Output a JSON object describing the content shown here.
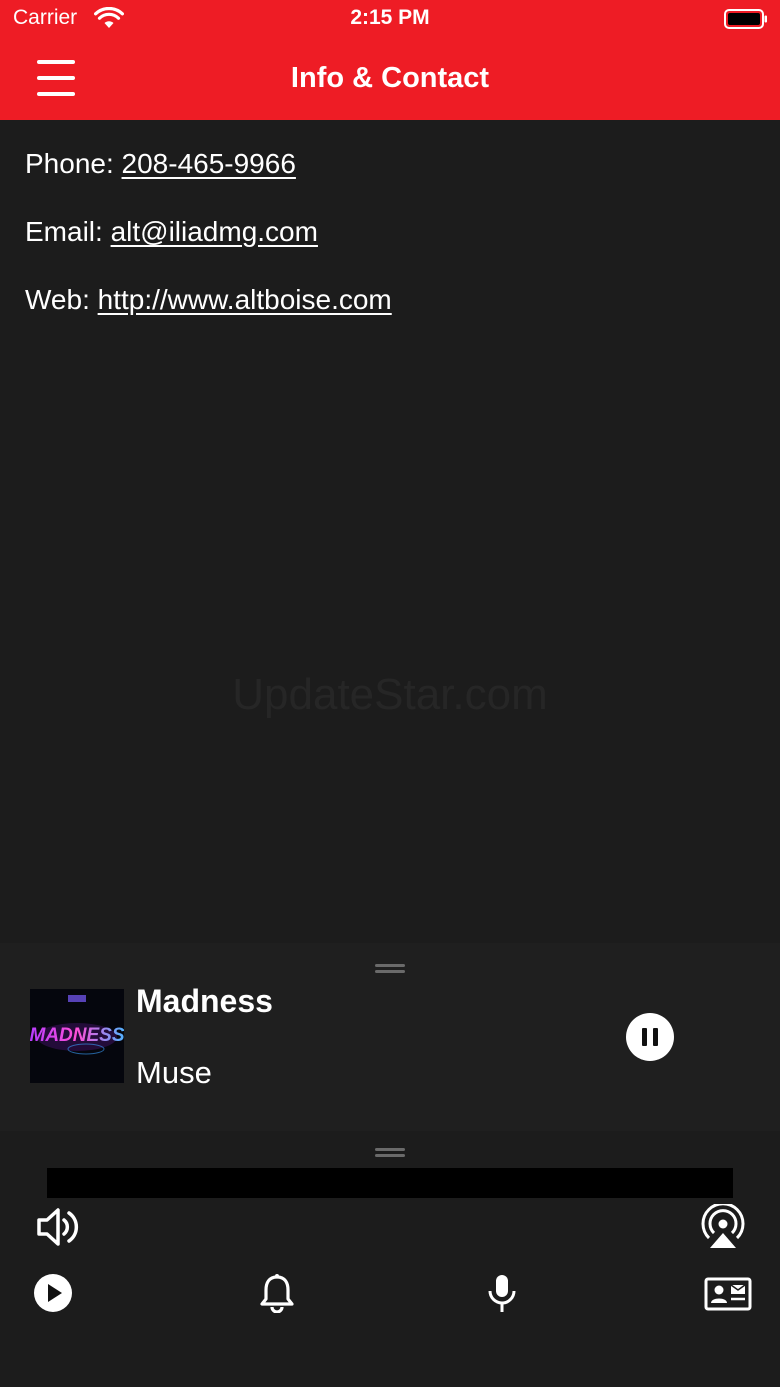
{
  "status_bar": {
    "carrier": "Carrier",
    "time": "2:15 PM"
  },
  "nav": {
    "title": "Info & Contact",
    "menu_icon": "hamburger-menu-icon"
  },
  "contact": {
    "phone_label": "Phone: ",
    "phone_value": "208-465-9966",
    "email_label": "Email: ",
    "email_value": "alt@iliadmg.com",
    "web_label": "Web: ",
    "web_value": "http://www.altboise.com"
  },
  "watermark": "UpdateStar.com",
  "player": {
    "track_title": "Madness",
    "artist": "Muse",
    "album_art_text": "MADNESS",
    "pause_icon": "pause-icon"
  },
  "controls": {
    "volume_icon": "speaker-volume-icon",
    "airplay_icon": "airplay-icon",
    "play_icon": "play-icon",
    "bell_icon": "bell-icon",
    "mic_icon": "microphone-icon",
    "contact_card_icon": "contact-card-icon"
  },
  "colors": {
    "accent": "#ee1c25",
    "background": "#1c1c1c",
    "player_background": "#1f1f1f"
  }
}
